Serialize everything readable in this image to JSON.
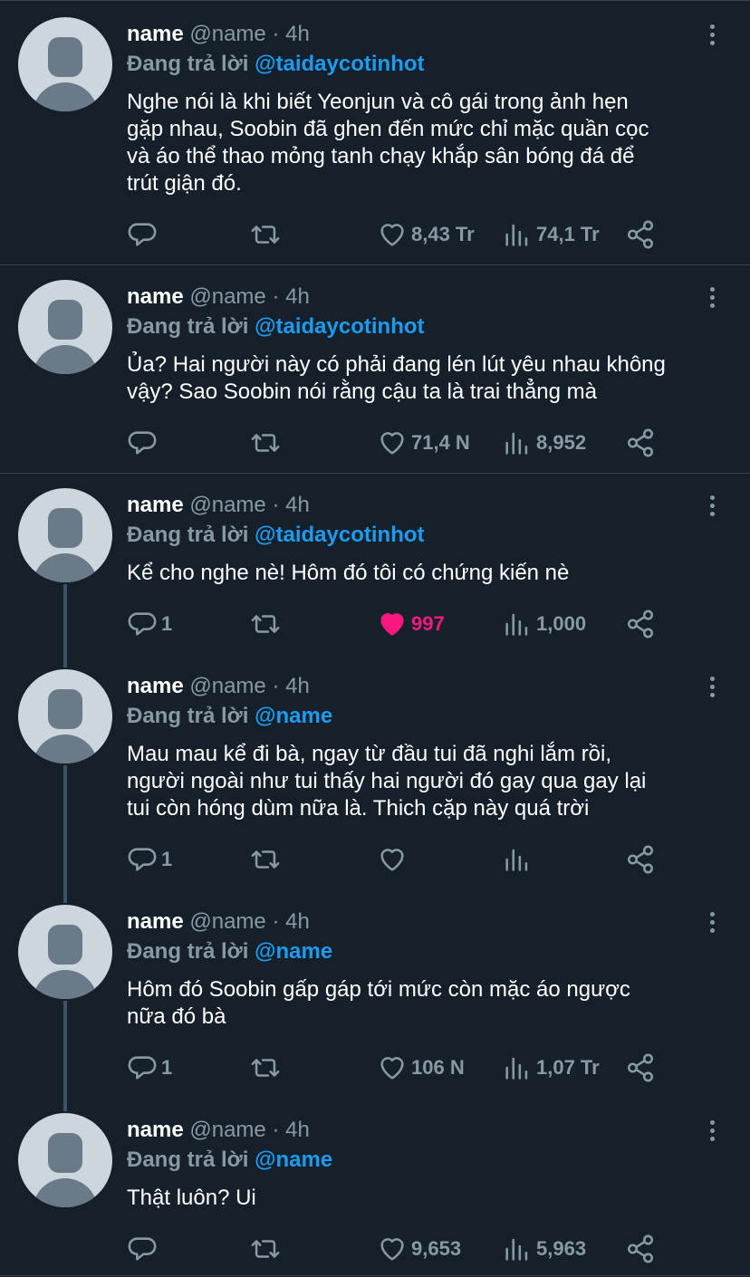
{
  "colors": {
    "background": "#15202b",
    "mention": "#1d9bf0",
    "muted": "#8899a6",
    "like": "#f91880"
  },
  "icons": {
    "reply": "reply-icon",
    "retweet": "retweet-icon",
    "like": "heart-icon",
    "views": "views-icon",
    "share": "share-icon",
    "more": "more-icon"
  },
  "tweets": [
    {
      "name": "name",
      "handle": "@name",
      "time": "· 4h",
      "reply_prefix": "Đang trả lời",
      "reply_to": "@taidaycotinhot",
      "text": "Nghe nói là khi biết Yeonjun và cô gái trong ảnh hẹn\ngặp nhau, Soobin đã ghen đến mức chỉ mặc quần cọc\nvà áo thể thao mỏng tanh chạy khắp sân bóng đá để\ntrút giận đó.",
      "replies": "",
      "retweets": "",
      "likes": "8,43 Tr",
      "views": "74,1 Tr",
      "liked": false
    },
    {
      "name": "name",
      "handle": "@name",
      "time": "· 4h",
      "reply_prefix": "Đang trả lời",
      "reply_to": "@taidaycotinhot",
      "text": "Ủa? Hai người này có phải đang lén lút yêu nhau không\nvậy? Sao Soobin nói rằng cậu ta là trai thẳng mà",
      "replies": "",
      "retweets": "",
      "likes": "71,4 N",
      "views": "8,952",
      "liked": false
    },
    {
      "name": "name",
      "handle": "@name",
      "time": "· 4h",
      "reply_prefix": "Đang trả lời",
      "reply_to": "@taidaycotinhot",
      "text": " Kể cho nghe nè! Hôm đó tôi có chứng kiến nè",
      "replies": "1",
      "retweets": "",
      "likes": "997",
      "views": "1,000",
      "liked": true
    },
    {
      "name": "name",
      "handle": "@name",
      "time": "· 4h",
      "reply_prefix": "Đang trả lời",
      "reply_to": "@name",
      "text": "Mau mau kể đi bà, ngay từ đầu tui đã nghi lắm rồi,\nngười ngoài như tui thấy hai người đó gay qua gay lại\ntui còn hóng dùm nữa là. Thich cặp này quá trời",
      "replies": "1",
      "retweets": "",
      "likes": "",
      "views": "",
      "liked": false
    },
    {
      "name": "name",
      "handle": "@name",
      "time": "· 4h",
      "reply_prefix": "Đang trả lời",
      "reply_to": "@name",
      "text": "Hôm đó Soobin gấp gáp tới mức còn mặc áo ngược\nnữa đó bà",
      "replies": "1",
      "retweets": "",
      "likes": "106 N",
      "views": "1,07 Tr",
      "liked": false
    },
    {
      "name": "name",
      "handle": "@name",
      "time": "· 4h",
      "reply_prefix": "Đang trả lời",
      "reply_to": "@name",
      "text": "Thật luôn? Ui",
      "replies": "",
      "retweets": "",
      "likes": "9,653",
      "views": "5,963",
      "liked": false
    }
  ]
}
